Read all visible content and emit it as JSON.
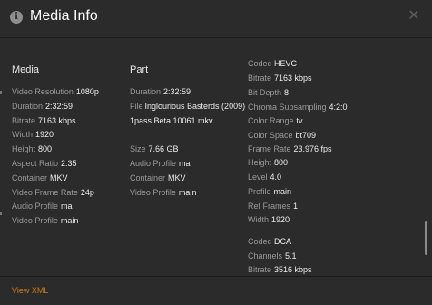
{
  "header": {
    "title": "Media Info",
    "info_icon": "info-icon",
    "close_icon": "close-icon"
  },
  "media": {
    "heading": "Media",
    "rows": [
      {
        "key": "Video Resolution",
        "value": "1080p"
      },
      {
        "key": "Duration",
        "value": "2:32:59"
      },
      {
        "key": "Bitrate",
        "value": "7163 kbps"
      },
      {
        "key": "Width",
        "value": "1920"
      },
      {
        "key": "Height",
        "value": "800"
      },
      {
        "key": "Aspect Ratio",
        "value": "2.35"
      },
      {
        "key": "Container",
        "value": "MKV"
      },
      {
        "key": "Video Frame Rate",
        "value": "24p"
      },
      {
        "key": "Audio Profile",
        "value": "ma"
      },
      {
        "key": "Video Profile",
        "value": "main"
      }
    ]
  },
  "part": {
    "heading": "Part",
    "rows": [
      {
        "key": "Duration",
        "value": "2:32:59"
      },
      {
        "key": "File",
        "value": "Inglourious Basterds (2009) 1pass Beta 10061.mkv"
      },
      {
        "key": "Size",
        "value": "7.66 GB"
      },
      {
        "key": "Audio Profile",
        "value": "ma"
      },
      {
        "key": "Container",
        "value": "MKV"
      },
      {
        "key": "Video Profile",
        "value": "main"
      }
    ]
  },
  "video_stream": {
    "rows": [
      {
        "key": "Codec",
        "value": "HEVC"
      },
      {
        "key": "Bitrate",
        "value": "7163 kbps"
      },
      {
        "key": "Bit Depth",
        "value": "8"
      },
      {
        "key": "Chroma Subsampling",
        "value": "4:2:0"
      },
      {
        "key": "Color Range",
        "value": "tv"
      },
      {
        "key": "Color Space",
        "value": "bt709"
      },
      {
        "key": "Frame Rate",
        "value": "23.976 fps"
      },
      {
        "key": "Height",
        "value": "800"
      },
      {
        "key": "Level",
        "value": "4.0"
      },
      {
        "key": "Profile",
        "value": "main"
      },
      {
        "key": "Ref Frames",
        "value": "1"
      },
      {
        "key": "Width",
        "value": "1920"
      }
    ]
  },
  "audio_stream": {
    "rows": [
      {
        "key": "Codec",
        "value": "DCA"
      },
      {
        "key": "Channels",
        "value": "5.1"
      },
      {
        "key": "Bitrate",
        "value": "3516 kbps"
      }
    ]
  },
  "footer": {
    "view_xml": "View XML"
  },
  "colors": {
    "background": "#2b2b2b",
    "accent": "#cc7b19",
    "key_text": "#9a9a9a",
    "value_text": "#ededed"
  }
}
